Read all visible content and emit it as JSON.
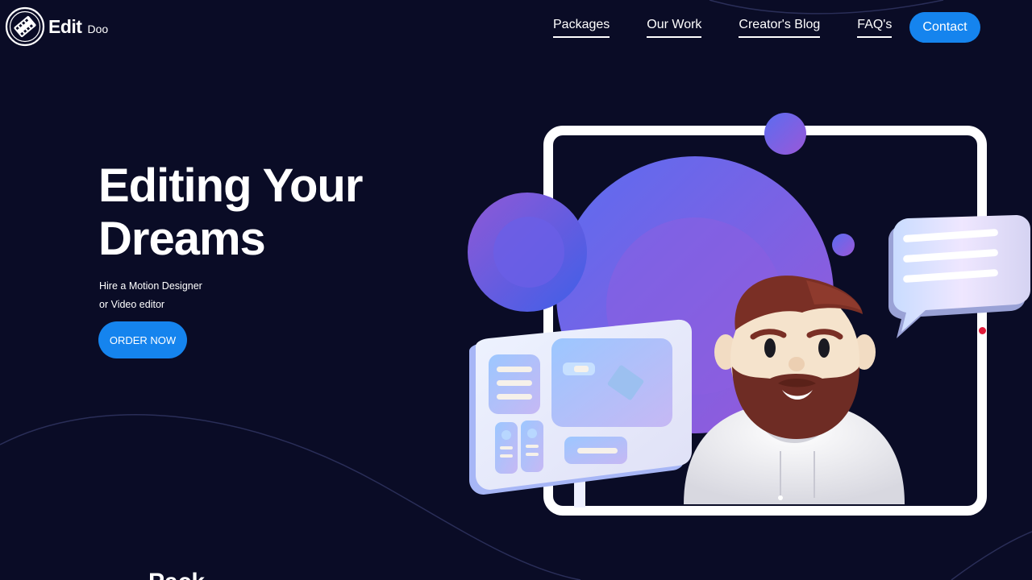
{
  "brand": {
    "name": "Edit",
    "suffix": "Doo"
  },
  "nav": {
    "items": [
      {
        "label": "Packages"
      },
      {
        "label": "Our Work"
      },
      {
        "label": "Creator's Blog"
      },
      {
        "label": "FAQ's"
      }
    ],
    "contact_label": "Contact"
  },
  "hero": {
    "title": "Editing Your Dreams",
    "subtitle_line1": "Hire a Motion Designer",
    "subtitle_line2": "or Video editor",
    "cta_label": "ORDER NOW"
  },
  "next_section": {
    "heading_peek": "Pack"
  },
  "colors": {
    "background": "#0a0c26",
    "accent": "#1584ee",
    "frame": "#ffffff",
    "purple": "#7b5fe0",
    "indicator": "#e11b39"
  },
  "icons": {
    "logo": "film-reel-logo-icon",
    "illustration": "bearded-creator-with-screen-and-chat-bubble"
  }
}
